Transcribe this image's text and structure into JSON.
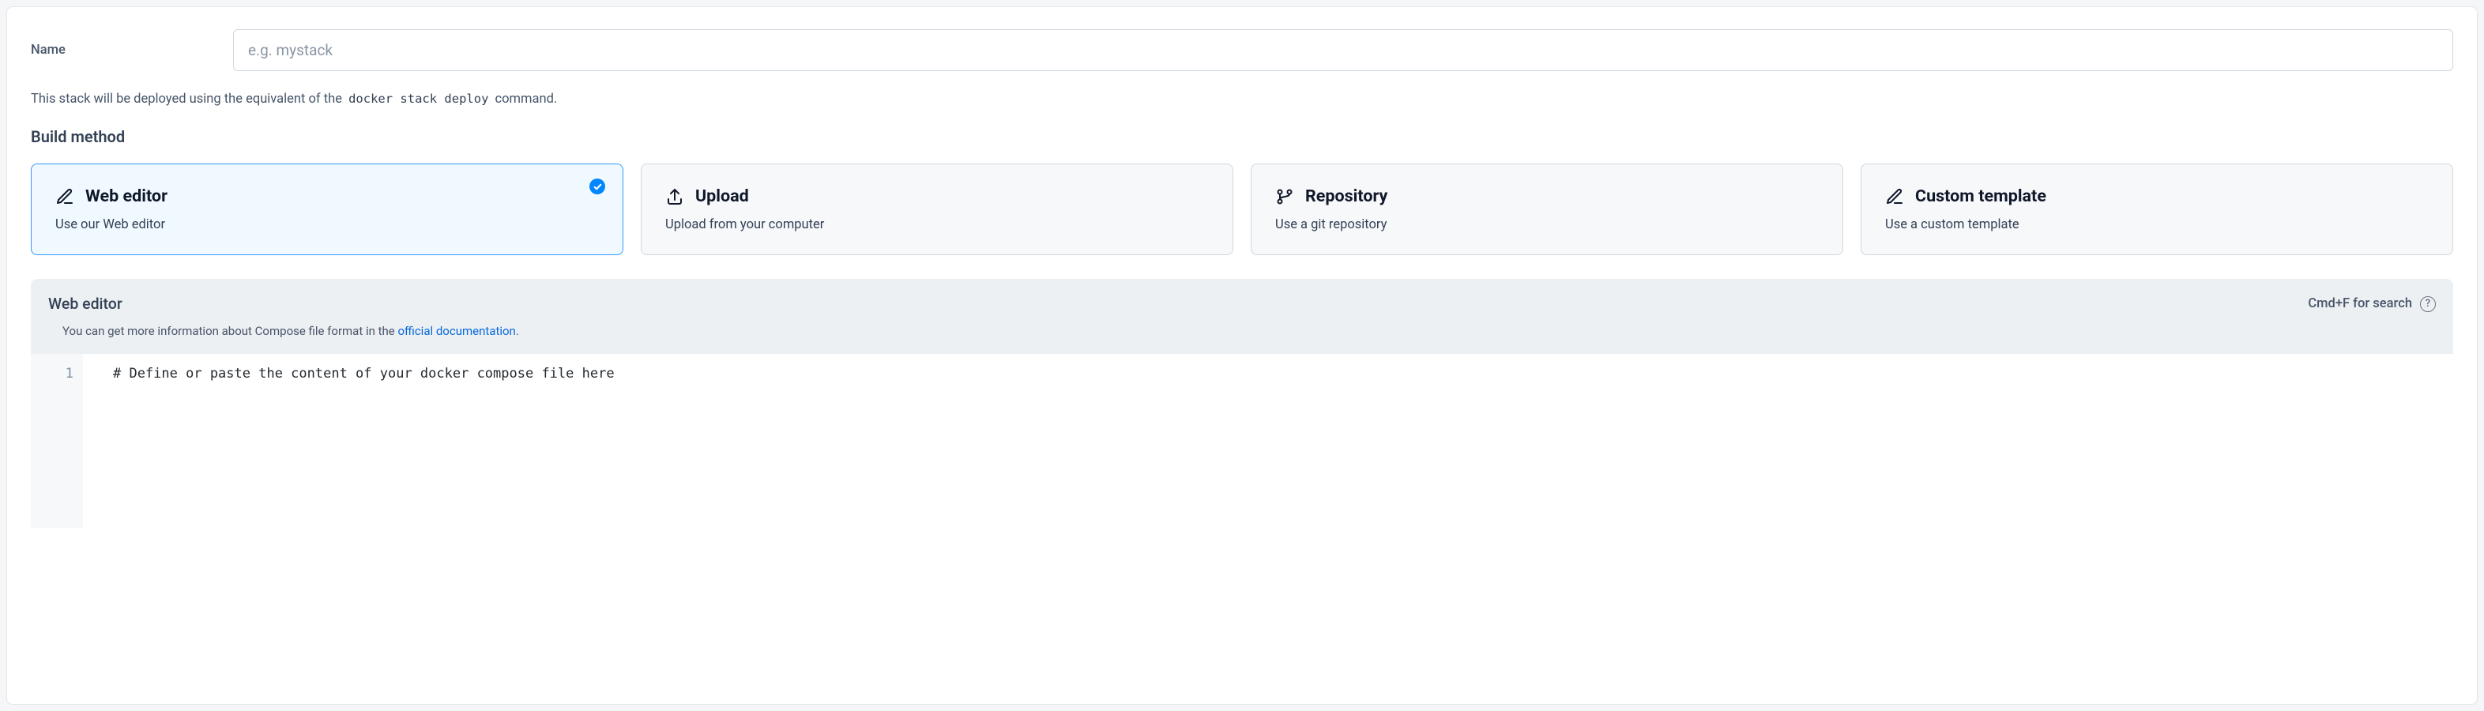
{
  "name_field": {
    "label": "Name",
    "placeholder": "e.g. mystack",
    "value": ""
  },
  "info_line": {
    "prefix": "This stack will be deployed using the equivalent of the ",
    "code": "docker stack deploy",
    "suffix": " command."
  },
  "build_method": {
    "title": "Build method",
    "cards": [
      {
        "key": "web-editor",
        "title": "Web editor",
        "subtitle": "Use our Web editor",
        "selected": true
      },
      {
        "key": "upload",
        "title": "Upload",
        "subtitle": "Upload from your computer",
        "selected": false
      },
      {
        "key": "repository",
        "title": "Repository",
        "subtitle": "Use a git repository",
        "selected": false
      },
      {
        "key": "custom-template",
        "title": "Custom template",
        "subtitle": "Use a custom template",
        "selected": false
      }
    ]
  },
  "editor": {
    "title": "Web editor",
    "search_hint": "Cmd+F for search",
    "help_text_prefix": "You can get more information about Compose file format in the ",
    "help_link_text": "official documentation",
    "help_text_suffix": ".",
    "lines": [
      {
        "num": "1",
        "text": "# Define or paste the content of your docker compose file here"
      }
    ]
  }
}
